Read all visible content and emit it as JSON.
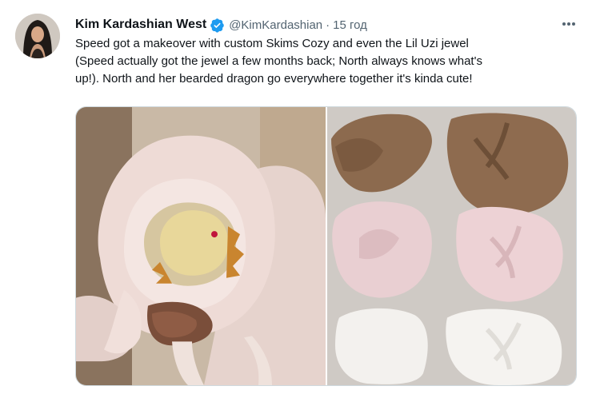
{
  "tweet": {
    "author_name": "Kim Kardashian West",
    "handle": "@KimKardashian",
    "separator": "·",
    "time": "15 год",
    "text_lines": [
      "Speed got a makeover with custom Skims Cozy and even the Lil Uzi jewel",
      "(Speed actually got the jewel a few months back; North always knows what's",
      "up!). North and her bearded dragon go everywhere together it's kinda cute!"
    ]
  },
  "icons": {
    "verified": "verified-badge-icon",
    "more": "more-options-icon"
  },
  "colors": {
    "verified_blue": "#1d9bf0",
    "secondary_text": "#536471",
    "primary_text": "#0f1419"
  }
}
